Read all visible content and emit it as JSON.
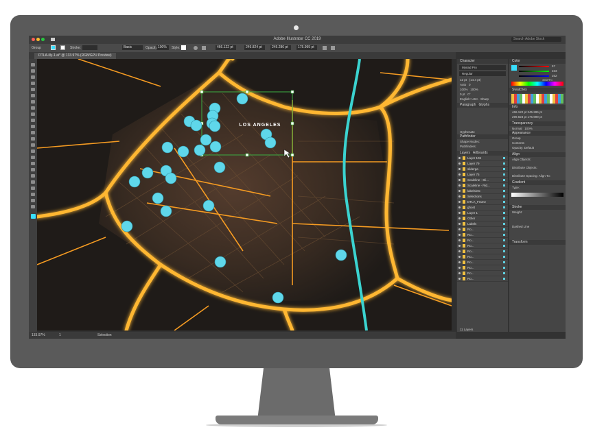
{
  "window": {
    "title": "Adobe Illustrator CC 2019",
    "search_placeholder": "Search Adobe Stock"
  },
  "controlbar": {
    "selection": "Group",
    "stroke_label": "Stroke:",
    "brush": "Basic",
    "opacity_label": "Opacity:",
    "opacity": "100%",
    "style_label": "Style:",
    "x": "466.122 pt",
    "y": "249.824 pt",
    "w": "245.286 pt",
    "h": "175.999 pt"
  },
  "document": {
    "tab_label": "DTLA-illy-1.ai* @ 133.97% (RGB/GPU Preview)"
  },
  "statusbar": {
    "zoom": "133.97%",
    "artboard": "1",
    "tool": "Selection"
  },
  "map": {
    "city_label": "LOS ANGELES"
  },
  "panels": {
    "character": {
      "title": "Character",
      "font": "Myriad Pro",
      "style": "Regular",
      "size": "12 pt",
      "leading": "(14.4 pt)",
      "tracking": "Auto",
      "kerning": "0",
      "scale_v": "100%",
      "scale_h": "100%",
      "baseline": "0 pt",
      "rotation": "0°",
      "language": "English: USA",
      "aa": "Sharp"
    },
    "paragraph_tab": "Paragraph",
    "glyphs_tab": "Glyphs",
    "hyphenate": "Hyphenate",
    "pathfinder": {
      "title": "Pathfinder",
      "shape_modes": "Shape Modes:",
      "pathfinders": "Pathfinders:",
      "expand": "Expand"
    },
    "layers": {
      "tabs": [
        "Layers",
        "Artboards"
      ],
      "rows": [
        "Layer 106",
        "Layer 79",
        "sliderga",
        "Layer 75",
        "Scaleline - Sli...",
        "Scaleline - Rid...",
        "labels/etc",
        "Selections",
        "DTLA_Frame",
        "ghost",
        "Layer 1",
        "Other",
        "Labels",
        "Ro...",
        "Ro...",
        "Ro...",
        "Ro...",
        "Ro...",
        "Ro...",
        "Ro...",
        "Ro...",
        "Ro...",
        "Ro..."
      ],
      "footer": "11 Layers"
    },
    "color": {
      "title": "Color",
      "r": "57",
      "g": "223",
      "b": "252",
      "hex": "39DFFC"
    },
    "swatches": {
      "title": "Swatches"
    },
    "info": {
      "title": "Info",
      "x": "466.122 pt",
      "y": "299.823 pt",
      "w": "245.286 pt",
      "h": "175.999 pt"
    },
    "transparency": {
      "title": "Transparency",
      "mode": "Normal",
      "opacity": "100%"
    },
    "appearance": {
      "title": "Appearance",
      "item": "Group",
      "contents": "Contents",
      "opacity": "Opacity: Default"
    },
    "align": {
      "title": "Align",
      "align_objects": "Align Objects:",
      "distribute_objects": "Distribute Objects:",
      "distribute_spacing": "Distribute Spacing:",
      "align_to": "Align To:"
    },
    "gradient": {
      "title": "Gradient",
      "type": "Type:"
    },
    "stroke": {
      "title": "Stroke",
      "weight_label": "Weight:",
      "dashed": "Dashed Line"
    },
    "transform": {
      "title": "Transform"
    }
  },
  "colors": {
    "accent": "#39DFFC",
    "road": "#FFB733",
    "river": "#3BD3D0",
    "selection": "#3CB043",
    "canvas": "#1F1B18"
  }
}
